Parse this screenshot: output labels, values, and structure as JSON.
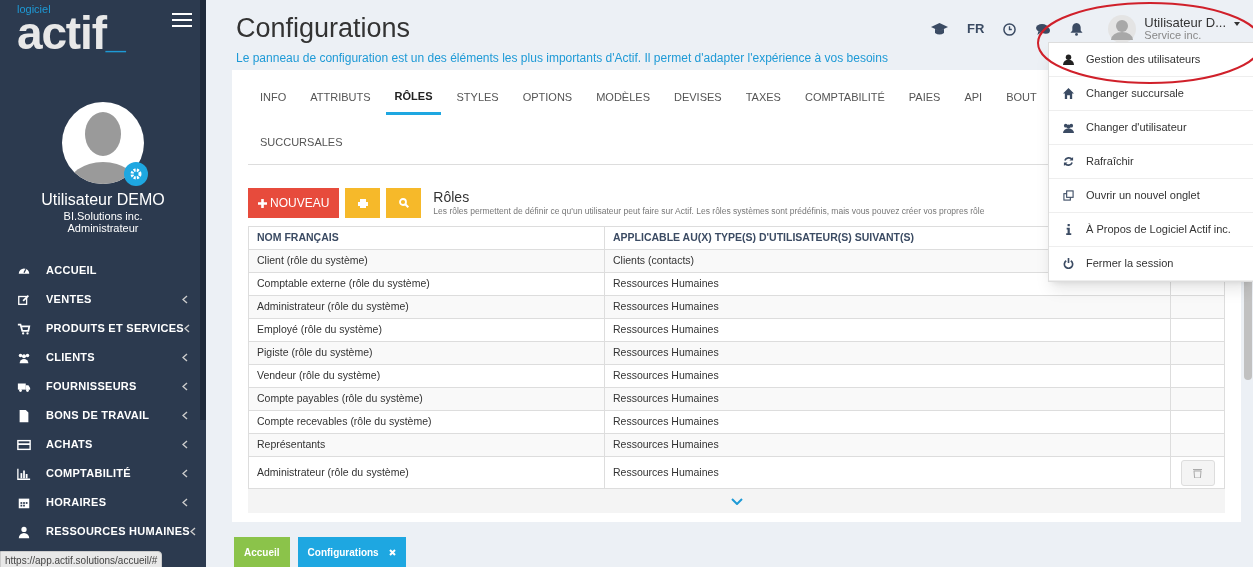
{
  "sidebar": {
    "logo": {
      "top": "logiciel",
      "name": "actif",
      "cursor": "_"
    },
    "user": {
      "name": "Utilisateur DEMO",
      "company": "BI.Solutions inc.",
      "role": "Administrateur"
    },
    "items": [
      {
        "label": "ACCUEIL",
        "has_children": false
      },
      {
        "label": "VENTES",
        "has_children": true
      },
      {
        "label": "PRODUITS ET SERVICES",
        "has_children": true
      },
      {
        "label": "CLIENTS",
        "has_children": true
      },
      {
        "label": "FOURNISSEURS",
        "has_children": true
      },
      {
        "label": "BONS DE TRAVAIL",
        "has_children": true
      },
      {
        "label": "ACHATS",
        "has_children": true
      },
      {
        "label": "COMPTABILITÉ",
        "has_children": true
      },
      {
        "label": "HORAIRES",
        "has_children": true
      },
      {
        "label": "RESSOURCES HUMAINES",
        "has_children": true
      }
    ]
  },
  "header": {
    "title": "Configurations",
    "subtitle": "Le panneau de configuration est un des éléments les plus importants d'Actif. Il permet d'adapter l'expérience à vos besoins",
    "language": "FR",
    "user_name": "Utilisateur D...",
    "user_company": "Service inc."
  },
  "tabs": [
    {
      "label": "INFO",
      "selected": false
    },
    {
      "label": "ATTRIBUTS",
      "selected": false
    },
    {
      "label": "RÔLES",
      "selected": true
    },
    {
      "label": "STYLES",
      "selected": false
    },
    {
      "label": "OPTIONS",
      "selected": false
    },
    {
      "label": "MODÈLES",
      "selected": false
    },
    {
      "label": "DEVISES",
      "selected": false
    },
    {
      "label": "TAXES",
      "selected": false
    },
    {
      "label": "COMPTABILITÉ",
      "selected": false
    },
    {
      "label": "PAIES",
      "selected": false
    },
    {
      "label": "API",
      "selected": false
    },
    {
      "label": "BOUT",
      "selected": false
    },
    {
      "label": "SUCCURSALES",
      "selected": false
    }
  ],
  "toolbar": {
    "new_button": "NOUVEAU",
    "heading": "Rôles",
    "description": "Les rôles permettent de définir ce qu'un utilisateur peut faire sur Actif. Les rôles systèmes sont prédéfinis, mais vous pouvez créer vos propres rôle"
  },
  "table": {
    "columns": [
      "NOM FRANÇAIS",
      "APPLICABLE AU(X) TYPE(S) D'UTILISATEUR(S) SUIVANT(S)"
    ],
    "rows": [
      {
        "cells": [
          "Client (rôle du système)",
          "Clients (contacts)"
        ],
        "delete_button": false
      },
      {
        "cells": [
          "Comptable externe (rôle du système)",
          "Ressources Humaines"
        ],
        "delete_button": false
      },
      {
        "cells": [
          "Administrateur (rôle du système)",
          "Ressources Humaines"
        ],
        "delete_button": false
      },
      {
        "cells": [
          "Employé (rôle du système)",
          "Ressources Humaines"
        ],
        "delete_button": false
      },
      {
        "cells": [
          "Pigiste (rôle du système)",
          "Ressources Humaines"
        ],
        "delete_button": false
      },
      {
        "cells": [
          "Vendeur (rôle du système)",
          "Ressources Humaines"
        ],
        "delete_button": false
      },
      {
        "cells": [
          "Compte payables (rôle du système)",
          "Ressources Humaines"
        ],
        "delete_button": false
      },
      {
        "cells": [
          "Compte recevables (rôle du système)",
          "Ressources Humaines"
        ],
        "delete_button": false
      },
      {
        "cells": [
          "Représentants",
          "Ressources Humaines"
        ],
        "delete_button": false
      },
      {
        "cells": [
          "Administrateur (rôle du système)",
          "Ressources Humaines"
        ],
        "delete_button": true
      }
    ]
  },
  "user_menu": {
    "items": [
      {
        "label": "Gestion des utilisateurs"
      },
      {
        "label": "Changer succursale"
      },
      {
        "label": "Changer d'utilisateur"
      },
      {
        "label": "Rafraîchir"
      },
      {
        "label": "Ouvrir un nouvel onglet"
      },
      {
        "label": "À Propos de Logiciel Actif inc."
      },
      {
        "label": "Fermer la session"
      }
    ]
  },
  "bottom_tabs": [
    {
      "label": "Accueil",
      "color": "#8bc34a",
      "closable": false
    },
    {
      "label": "Configurations",
      "color": "#1ea7e1",
      "closable": true
    }
  ],
  "status_url": "https://app.actif.solutions/accueil/#"
}
